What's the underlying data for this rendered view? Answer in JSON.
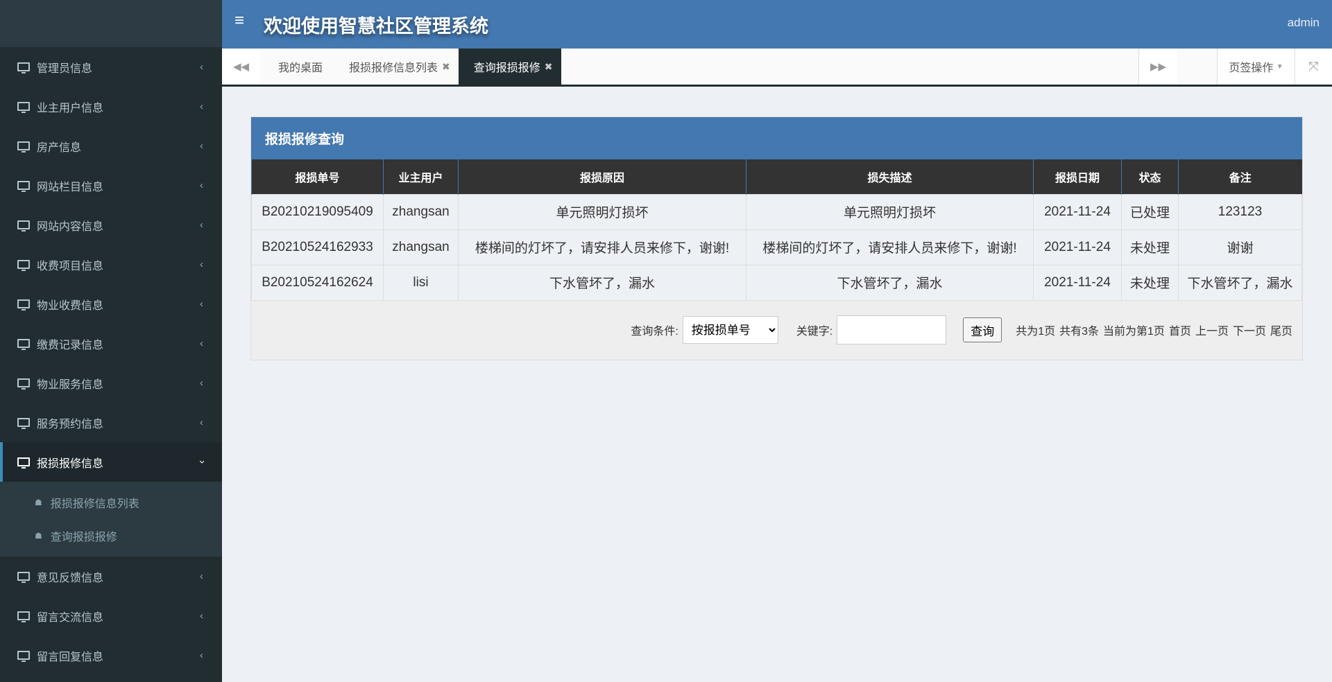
{
  "header": {
    "title": "欢迎使用智慧社区管理系统",
    "user": "admin"
  },
  "sidebar": {
    "items": [
      {
        "label": "管理员信息"
      },
      {
        "label": "业主用户信息"
      },
      {
        "label": "房产信息"
      },
      {
        "label": "网站栏目信息"
      },
      {
        "label": "网站内容信息"
      },
      {
        "label": "收费项目信息"
      },
      {
        "label": "物业收费信息"
      },
      {
        "label": "缴费记录信息"
      },
      {
        "label": "物业服务信息"
      },
      {
        "label": "服务预约信息"
      },
      {
        "label": "报损报修信息"
      },
      {
        "label": "意见反馈信息"
      },
      {
        "label": "留言交流信息"
      },
      {
        "label": "留言回复信息"
      }
    ],
    "submenu": [
      {
        "label": "报损报修信息列表"
      },
      {
        "label": "查询报损报修"
      }
    ]
  },
  "tabs": {
    "items": [
      {
        "label": "我的桌面"
      },
      {
        "label": "报损报修信息列表"
      },
      {
        "label": "查询报损报修"
      }
    ],
    "page_ops": "页签操作"
  },
  "panel": {
    "title": "报损报修查询",
    "columns": [
      "报损单号",
      "业主用户",
      "报损原因",
      "损失描述",
      "报损日期",
      "状态",
      "备注"
    ],
    "rows": [
      [
        "B20210219095409",
        "zhangsan",
        "单元照明灯损坏",
        "单元照明灯损坏",
        "2021-11-24",
        "已处理",
        "123123"
      ],
      [
        "B20210524162933",
        "zhangsan",
        "楼梯间的灯坏了，请安排人员来修下，谢谢!",
        "楼梯间的灯坏了，请安排人员来修下，谢谢!",
        "2021-11-24",
        "未处理",
        "谢谢"
      ],
      [
        "B20210524162624",
        "lisi",
        "下水管坏了，漏水",
        "下水管坏了，漏水",
        "2021-11-24",
        "未处理",
        "下水管坏了，漏水"
      ]
    ]
  },
  "footer": {
    "cond_label": "查询条件:",
    "cond_value": "按报损单号",
    "keyword_label": "关键字:",
    "keyword_value": "",
    "search": "查询",
    "pager": [
      "共为1页",
      "共有3条",
      "当前为第1页",
      "首页",
      "上一页",
      "下一页",
      "尾页"
    ]
  }
}
